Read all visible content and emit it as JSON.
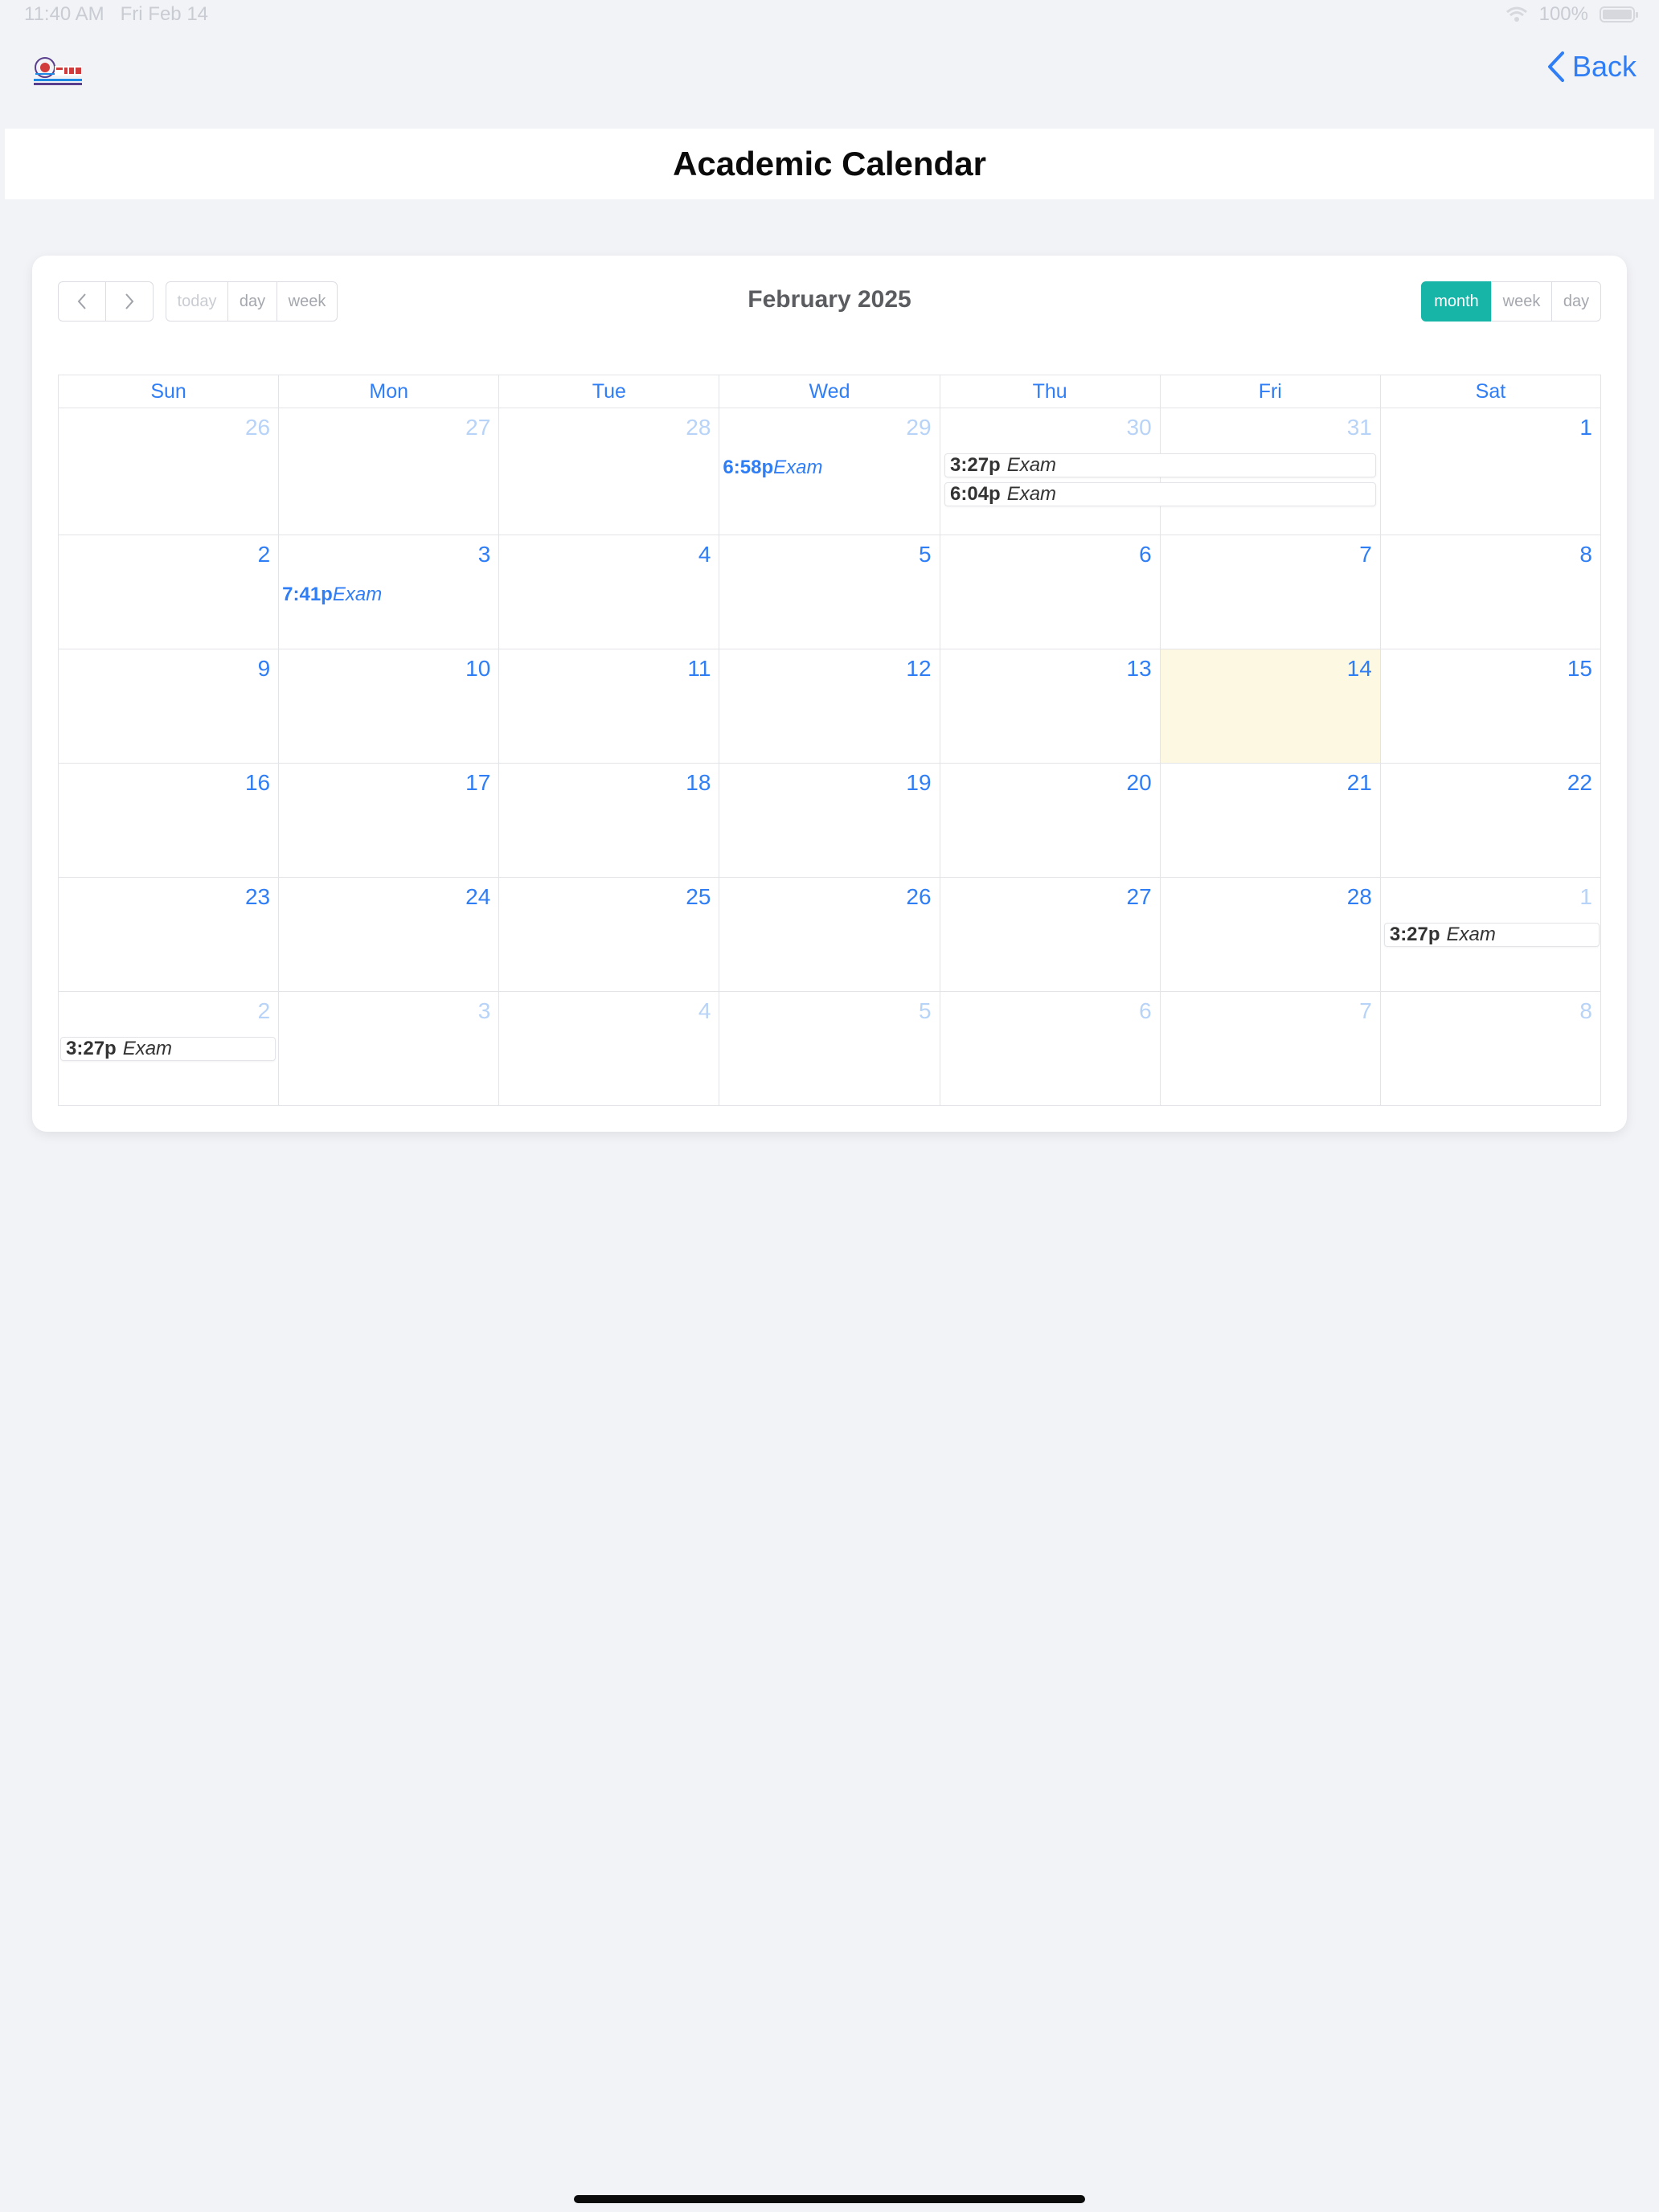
{
  "status": {
    "time": "11:40 AM",
    "date": "Fri Feb 14",
    "battery": "100%"
  },
  "nav": {
    "back_label": "Back"
  },
  "page_title": "Academic Calendar",
  "calendar": {
    "title": "February 2025",
    "nav_buttons": {
      "prev": "‹",
      "next": "›"
    },
    "left_buttons": [
      "today",
      "day",
      "week"
    ],
    "view_buttons": [
      "month",
      "week",
      "day"
    ],
    "active_view": "month",
    "weekdays": [
      "Sun",
      "Mon",
      "Tue",
      "Wed",
      "Thu",
      "Fri",
      "Sat"
    ],
    "weeks": [
      [
        "26",
        "27",
        "28",
        "29",
        "30",
        "31",
        "1"
      ],
      [
        "2",
        "3",
        "4",
        "5",
        "6",
        "7",
        "8"
      ],
      [
        "9",
        "10",
        "11",
        "12",
        "13",
        "14",
        "15"
      ],
      [
        "16",
        "17",
        "18",
        "19",
        "20",
        "21",
        "22"
      ],
      [
        "23",
        "24",
        "25",
        "26",
        "27",
        "28",
        "1"
      ],
      [
        "2",
        "3",
        "4",
        "5",
        "6",
        "7",
        "8"
      ]
    ],
    "events": {
      "wed_29": {
        "time": "6:58p",
        "title": "Exam"
      },
      "thu_30_a": {
        "time": "3:27p",
        "title": "Exam"
      },
      "thu_30_b": {
        "time": "6:04p",
        "title": "Exam"
      },
      "mon_3": {
        "time": "7:41p",
        "title": "Exam"
      },
      "sat_1": {
        "time": "3:27p",
        "title": "Exam"
      },
      "sun_2": {
        "time": "3:27p",
        "title": "Exam"
      }
    },
    "colors": {
      "accent": "#2f7ef6",
      "active_view": "#16b5a8",
      "today_bg": "#fcf8e2"
    }
  }
}
